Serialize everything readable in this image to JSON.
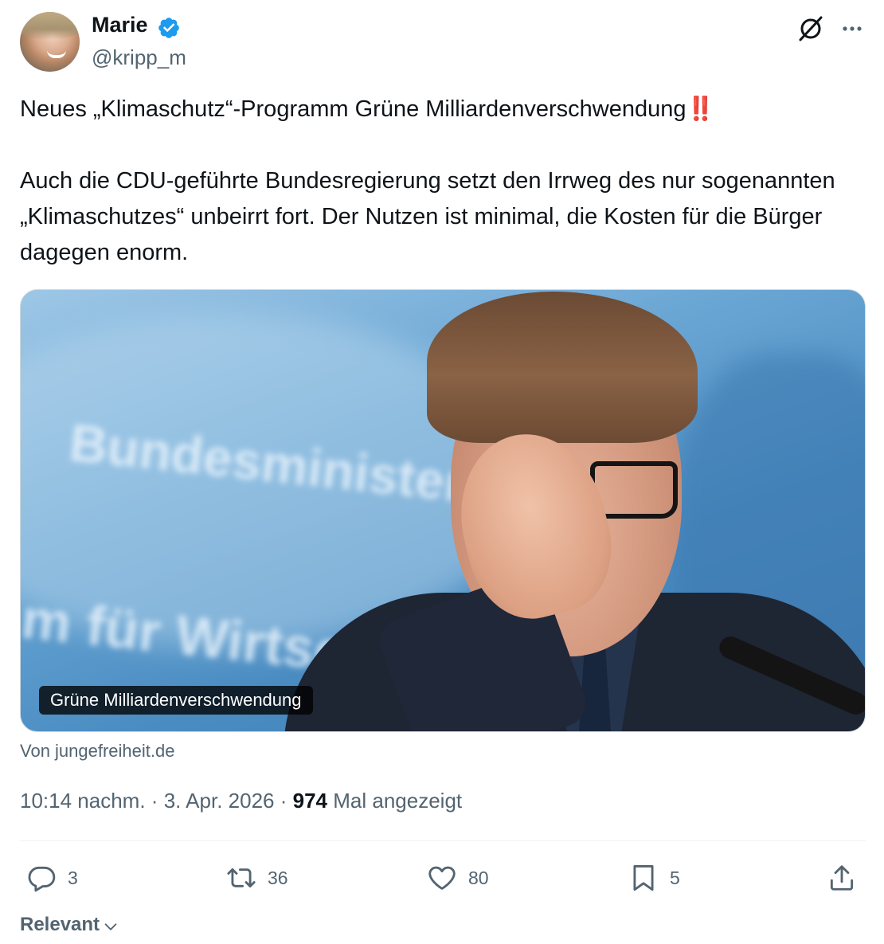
{
  "author": {
    "display_name": "Marie",
    "handle": "@kripp_m",
    "verified": true
  },
  "tweet": {
    "text_line1": "Neues „Klimaschutz“-Programm Grüne Milliardenverschwendung",
    "text_line1_emoji": "‼️",
    "text_paragraph2": "Auch die CDU-geführte Bundesregierung setzt den Irrweg des nur sogenannten „Klimaschutzes“ unbeirrt fort. Der Nutzen ist minimal, die Kosten für die Bürger dagegen enorm."
  },
  "card": {
    "caption": "Grüne Milliardenverschwendung",
    "background_text_1": "Bundesministerium",
    "background_text_2": "m für Wirtschaft",
    "source": "Von jungefreiheit.de"
  },
  "meta": {
    "time": "10:14 nachm.",
    "separator": "·",
    "date": "3. Apr. 2026",
    "views_count": "974",
    "views_label": "Mal angezeigt"
  },
  "actions": {
    "replies": "3",
    "reposts": "36",
    "likes": "80",
    "bookmarks": "5"
  },
  "sort": {
    "label": "Relevant"
  },
  "icons": {
    "verified": "verified-badge-icon",
    "grok": "grok-icon",
    "more": "more-icon",
    "reply": "reply-icon",
    "repost": "repost-icon",
    "like": "heart-icon",
    "bookmark": "bookmark-icon",
    "share": "share-icon",
    "chevron": "chevron-down-icon"
  },
  "colors": {
    "accent": "#1d9bf0",
    "secondary_text": "#536471",
    "primary_text": "#0f1419",
    "emoji_red": "#d0181e"
  }
}
